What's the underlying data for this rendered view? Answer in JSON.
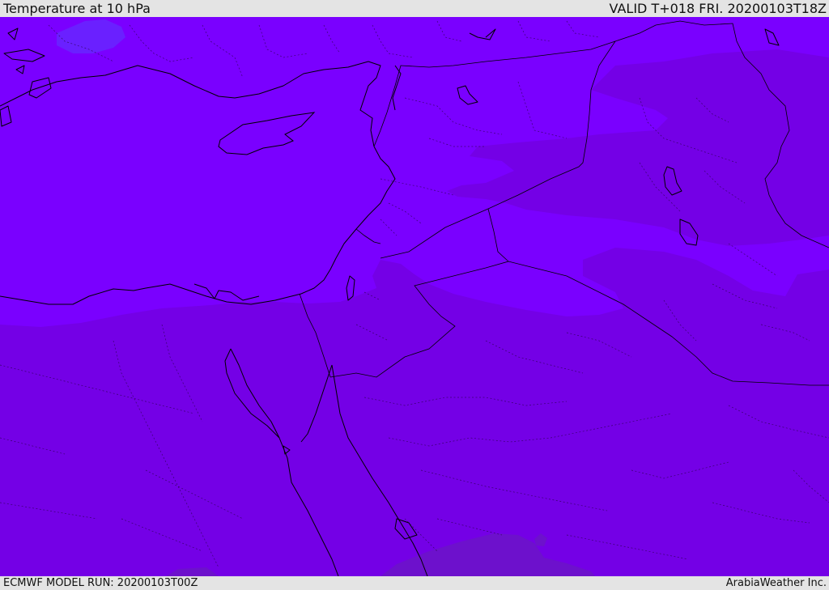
{
  "header": {
    "title": "Temperature at 10 hPa",
    "valid_time": "VALID T+018 FRI. 20200103T18Z"
  },
  "footer": {
    "model_run": "ECMWF MODEL RUN: 20200103T00Z",
    "credit": "ArabiaWeather Inc."
  },
  "colors": {
    "band_cold": "#7a00ff",
    "band_mid": "#7400e6",
    "band_warm": "#6d11cc",
    "band_coldest": "#6a20ff",
    "bar_background": "#e4e4e4"
  }
}
